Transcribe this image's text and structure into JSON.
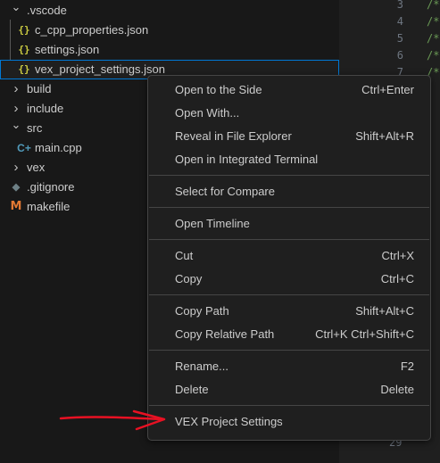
{
  "explorer": {
    "items": [
      {
        "label": ".vscode",
        "kind": "folder",
        "state": "expanded"
      },
      {
        "label": "c_cpp_properties.json",
        "kind": "file",
        "icon": "json-icon",
        "glyph": "{}"
      },
      {
        "label": "settings.json",
        "kind": "file",
        "icon": "json-icon",
        "glyph": "{}"
      },
      {
        "label": "vex_project_settings.json",
        "kind": "file",
        "icon": "json-icon",
        "glyph": "{}",
        "selected": true
      },
      {
        "label": "build",
        "kind": "folder",
        "state": "collapsed"
      },
      {
        "label": "include",
        "kind": "folder",
        "state": "collapsed"
      },
      {
        "label": "src",
        "kind": "folder",
        "state": "expanded"
      },
      {
        "label": "main.cpp",
        "kind": "file",
        "icon": "cpp-icon",
        "glyph": "C+"
      },
      {
        "label": "vex",
        "kind": "folder",
        "state": "collapsed"
      },
      {
        "label": ".gitignore",
        "kind": "file",
        "icon": "git-icon",
        "glyph": "◆"
      },
      {
        "label": "makefile",
        "kind": "file",
        "icon": "makefile-icon",
        "glyph": "M"
      }
    ]
  },
  "editor": {
    "lines": [
      {
        "num": "3",
        "code": "/*"
      },
      {
        "num": "4",
        "code": "/*"
      },
      {
        "num": "5",
        "code": "/*"
      },
      {
        "num": "6",
        "code": "/*"
      },
      {
        "num": "7",
        "code": "/*"
      }
    ],
    "bottom_line_num": "29",
    "comment_color": "#6a9955"
  },
  "context_menu": {
    "groups": [
      [
        {
          "label": "Open to the Side",
          "shortcut": "Ctrl+Enter"
        },
        {
          "label": "Open With...",
          "shortcut": ""
        },
        {
          "label": "Reveal in File Explorer",
          "shortcut": "Shift+Alt+R"
        },
        {
          "label": "Open in Integrated Terminal",
          "shortcut": ""
        }
      ],
      [
        {
          "label": "Select for Compare",
          "shortcut": ""
        }
      ],
      [
        {
          "label": "Open Timeline",
          "shortcut": ""
        }
      ],
      [
        {
          "label": "Cut",
          "shortcut": "Ctrl+X"
        },
        {
          "label": "Copy",
          "shortcut": "Ctrl+C"
        }
      ],
      [
        {
          "label": "Copy Path",
          "shortcut": "Shift+Alt+C"
        },
        {
          "label": "Copy Relative Path",
          "shortcut": "Ctrl+K Ctrl+Shift+C"
        }
      ],
      [
        {
          "label": "Rename...",
          "shortcut": "F2"
        },
        {
          "label": "Delete",
          "shortcut": "Delete"
        }
      ],
      [
        {
          "label": "VEX Project Settings",
          "shortcut": ""
        }
      ]
    ]
  },
  "colors": {
    "selection_border": "#0078d4",
    "annotation_arrow": "#e81123"
  }
}
